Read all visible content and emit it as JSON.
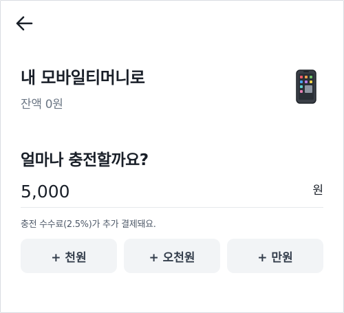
{
  "header": {
    "back_icon": "arrow-left-icon"
  },
  "wallet": {
    "title": "내 모바일티머니로",
    "balance": "잔액 0원",
    "icon": "smartphone-icon"
  },
  "charge": {
    "question": "얼마나 충전할까요?",
    "amount_value": "5,000",
    "unit": "원",
    "fee_note": "충전 수수료(2.5%)가 추가 결제돼요."
  },
  "quick_add": [
    {
      "label": "+ 천원"
    },
    {
      "label": "+ 오천원"
    },
    {
      "label": "+ 만원"
    }
  ],
  "colors": {
    "text_primary": "#191f28",
    "text_secondary": "#6b7684",
    "chip_bg": "#f2f4f6"
  }
}
